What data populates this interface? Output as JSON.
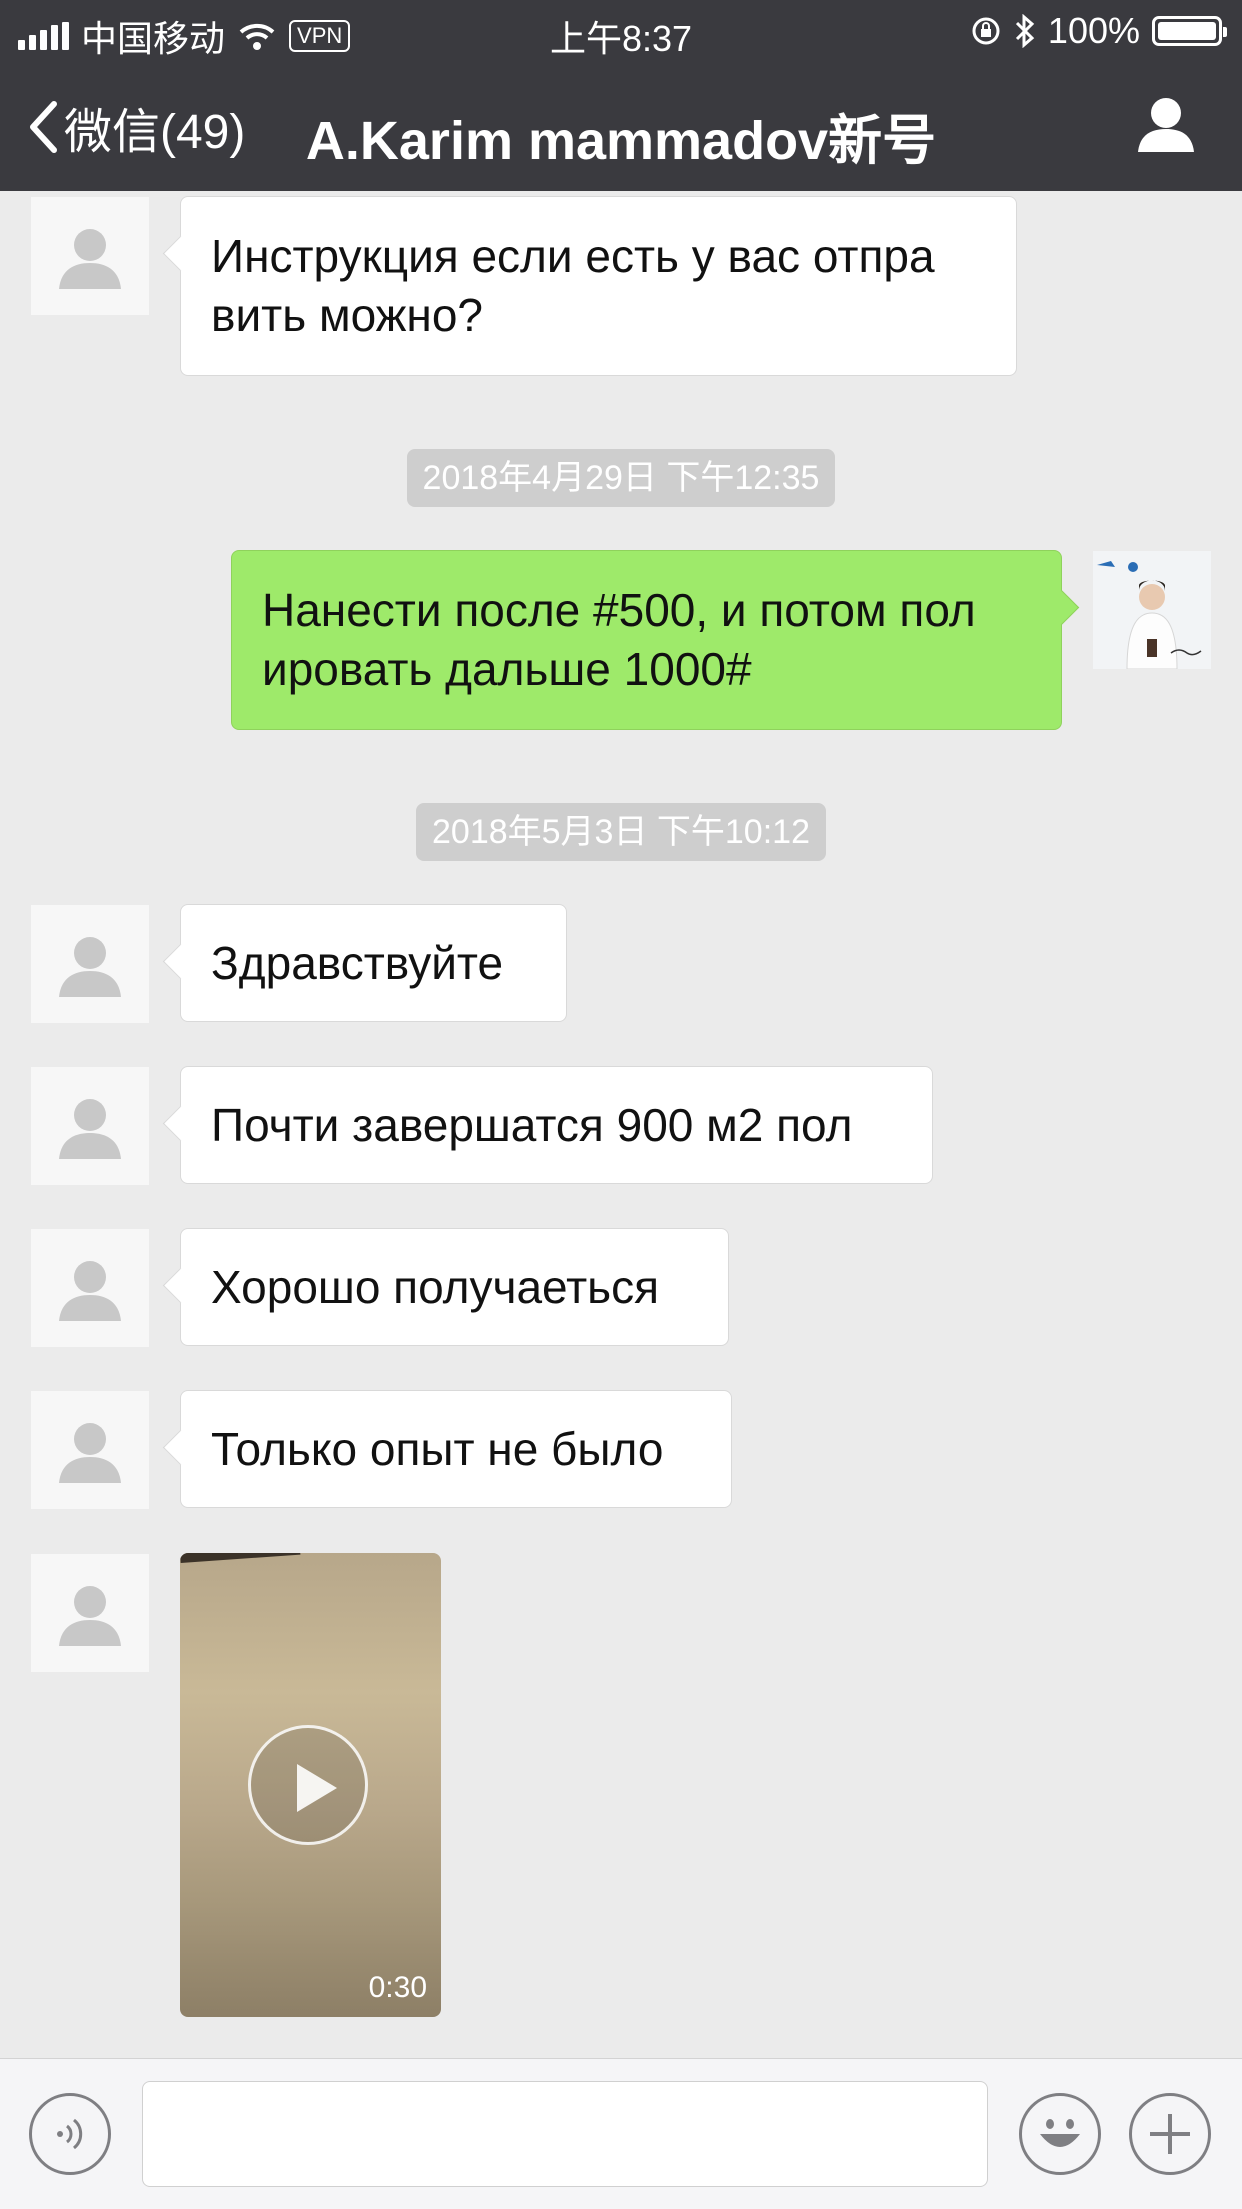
{
  "status_bar": {
    "carrier": "中国移动",
    "vpn": "VPN",
    "time": "上午8:37",
    "battery": "100%"
  },
  "nav": {
    "back_label": "微信(49)",
    "title": "A.Karim mammadov新号"
  },
  "messages": [
    {
      "from": "contact",
      "text": "Инструкция если есть у вас отпра\nвить можно?"
    },
    {
      "type": "timestamp",
      "text": "2018年4月29日 下午12:35"
    },
    {
      "from": "me",
      "text": "Нанести после #500, и потом пол\nировать дальше 1000#"
    },
    {
      "type": "timestamp",
      "text": "2018年5月3日 下午10:12"
    },
    {
      "from": "contact",
      "text": "Здравствуйте"
    },
    {
      "from": "contact",
      "text": "Почти завершатся 900 м2 пол"
    },
    {
      "from": "contact",
      "text": "Хорошо получаеться"
    },
    {
      "from": "contact",
      "text": "Только опыт не было"
    },
    {
      "from": "contact",
      "type": "video",
      "duration": "0:30"
    }
  ],
  "icons": {
    "back": "chevron-left-icon",
    "profile": "person-icon",
    "voice": "voice-icon",
    "emoji": "emoji-icon",
    "plus": "plus-icon",
    "play": "play-icon"
  },
  "colors": {
    "header": "#3a3a3f",
    "background": "#ebebeb",
    "outgoing_bubble": "#9eea6a",
    "incoming_bubble": "#ffffff"
  }
}
